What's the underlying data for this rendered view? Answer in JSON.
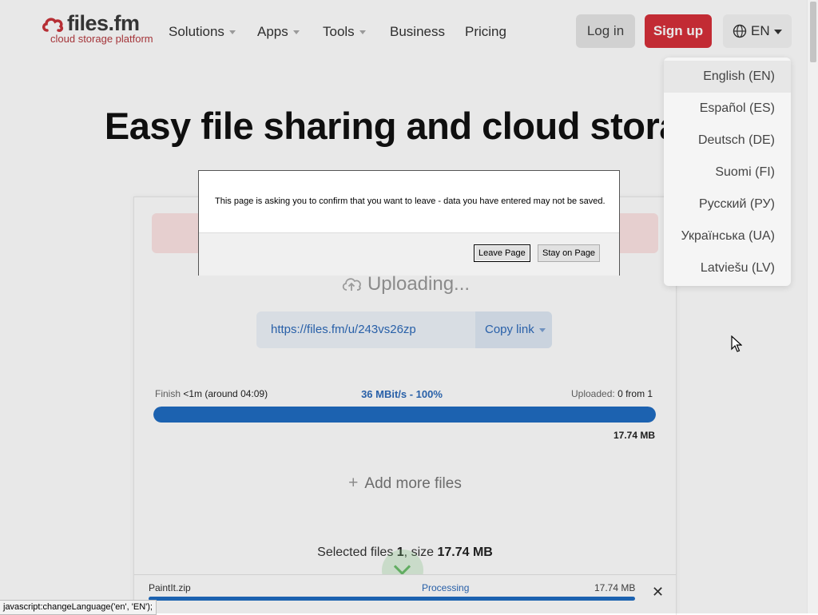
{
  "header": {
    "logo_name": "files.fm",
    "logo_tagline": "cloud storage platform",
    "nav": [
      {
        "label": "Solutions",
        "has_dropdown": true
      },
      {
        "label": "Apps",
        "has_dropdown": true
      },
      {
        "label": "Tools",
        "has_dropdown": true
      },
      {
        "label": "Business",
        "has_dropdown": false
      },
      {
        "label": "Pricing",
        "has_dropdown": false
      }
    ],
    "login": "Log in",
    "signup": "Sign up",
    "language_code": "EN"
  },
  "hero": {
    "title": "Easy file sharing and cloud storag"
  },
  "language_menu": {
    "items": [
      "English (EN)",
      "Español (ES)",
      "Deutsch (DE)",
      "Suomi (FI)",
      "Русский (РУ)",
      "Українська (UA)",
      "Latviešu (LV)"
    ],
    "active_index": 0
  },
  "upload": {
    "status": "Uploading...",
    "share_url": "https://files.fm/u/243vs26zp",
    "copy_link": "Copy link",
    "finish_label": "Finish",
    "finish_value": "<1m (around 04:09)",
    "speed": "36 MBit/s - 100%",
    "uploaded_label": "Uploaded:",
    "uploaded_value": "0 from 1",
    "progress_percent": 100,
    "total_size": "17.74 MB",
    "add_more": "Add more files",
    "selected_prefix": "Selected files ",
    "selected_count": "1",
    "selected_mid": ", size ",
    "selected_size": "17.74 MB",
    "file": {
      "name": "PaintIt.zip",
      "status": "Processing",
      "size": "17.74 MB",
      "progress_percent": 100
    }
  },
  "dialog": {
    "message": "This page is asking you to confirm that you want to leave - data you have entered may not be saved.",
    "leave": "Leave Page",
    "stay": "Stay on Page"
  },
  "statusbar": {
    "text": "javascript:changeLanguage('en', 'EN');"
  },
  "colors": {
    "brand_red": "#d6303a",
    "link_blue": "#2d6ab9",
    "progress_blue": "#1f6cc2"
  }
}
